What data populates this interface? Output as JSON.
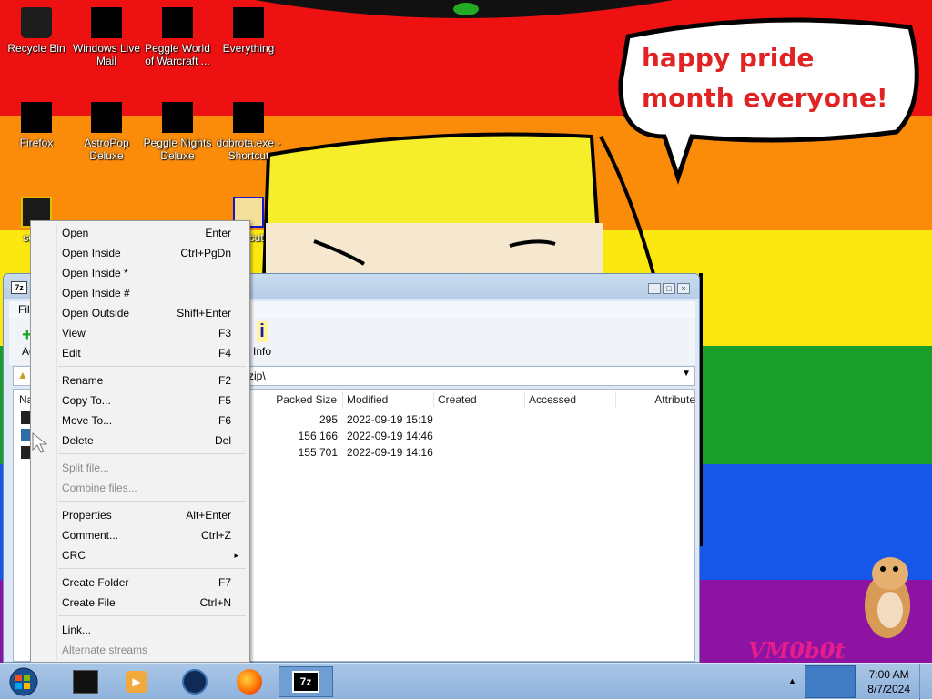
{
  "desktop": {
    "icons": [
      {
        "label": "Recycle Bin",
        "icon": "recycle-bin-icon"
      },
      {
        "label": "Windows Live Mail",
        "icon": "windows-live-mail-icon"
      },
      {
        "label": "Peggle World of Warcraft ...",
        "icon": "peggle-wow-icon"
      },
      {
        "label": "Everything",
        "icon": "everything-icon"
      },
      {
        "label": "Firefox",
        "icon": "firefox-icon"
      },
      {
        "label": "AstroPop Deluxe",
        "icon": "astropop-icon"
      },
      {
        "label": "Peggle Nights Deluxe",
        "icon": "peggle-nights-icon"
      },
      {
        "label": "dobrota.exe - Shortcut",
        "icon": "exe-shortcut-icon"
      },
      {
        "label": "some",
        "icon": "file-icon"
      },
      {
        "label": "p - cut",
        "icon": "zip-shortcut-icon"
      }
    ],
    "wallpaper_text": "happy pride month everyone!",
    "watermark": "VM0b0t"
  },
  "window": {
    "title_icon": "7z",
    "menu_first": "File",
    "toolbar": {
      "add_label": "Ad",
      "info_label": "Info"
    },
    "address": "zip\\",
    "columns": [
      "Na",
      "Packed Size",
      "Modified",
      "Created",
      "Accessed",
      "Attribute"
    ],
    "rows": [
      {
        "packed": "295",
        "modified": "2022-09-19 15:19"
      },
      {
        "packed": "156 166",
        "modified": "2022-09-19 14:46"
      },
      {
        "packed": "155 701",
        "modified": "2022-09-19 14:16"
      }
    ]
  },
  "context_menu": {
    "items": [
      {
        "label": "Open",
        "shortcut": "Enter",
        "disabled": false
      },
      {
        "label": "Open Inside",
        "shortcut": "Ctrl+PgDn",
        "disabled": false
      },
      {
        "label": "Open Inside *",
        "shortcut": "",
        "disabled": false
      },
      {
        "label": "Open Inside #",
        "shortcut": "",
        "disabled": false
      },
      {
        "label": "Open Outside",
        "shortcut": "Shift+Enter",
        "disabled": false
      },
      {
        "label": "View",
        "shortcut": "F3",
        "disabled": false
      },
      {
        "label": "Edit",
        "shortcut": "F4",
        "disabled": false
      },
      {
        "label": "Rename",
        "shortcut": "F2",
        "disabled": false
      },
      {
        "label": "Copy To...",
        "shortcut": "F5",
        "disabled": false
      },
      {
        "label": "Move To...",
        "shortcut": "F6",
        "disabled": false
      },
      {
        "label": "Delete",
        "shortcut": "Del",
        "disabled": false
      },
      {
        "label": "Split file...",
        "shortcut": "",
        "disabled": true
      },
      {
        "label": "Combine files...",
        "shortcut": "",
        "disabled": true
      },
      {
        "label": "Properties",
        "shortcut": "Alt+Enter",
        "disabled": false
      },
      {
        "label": "Comment...",
        "shortcut": "Ctrl+Z",
        "disabled": false
      },
      {
        "label": "CRC",
        "shortcut": "▸",
        "disabled": false
      },
      {
        "label": "Create Folder",
        "shortcut": "F7",
        "disabled": false
      },
      {
        "label": "Create File",
        "shortcut": "Ctrl+N",
        "disabled": false
      },
      {
        "label": "Link...",
        "shortcut": "",
        "disabled": false
      },
      {
        "label": "Alternate streams",
        "shortcut": "",
        "disabled": true
      }
    ]
  },
  "taskbar": {
    "apps": [
      "start-orb-icon",
      "terminal-icon",
      "media-player-icon",
      "browser-icon",
      "firefox-icon",
      "7zip-icon"
    ],
    "active_app_label": "7z",
    "time": "7:00 AM",
    "date": "8/7/2024"
  }
}
